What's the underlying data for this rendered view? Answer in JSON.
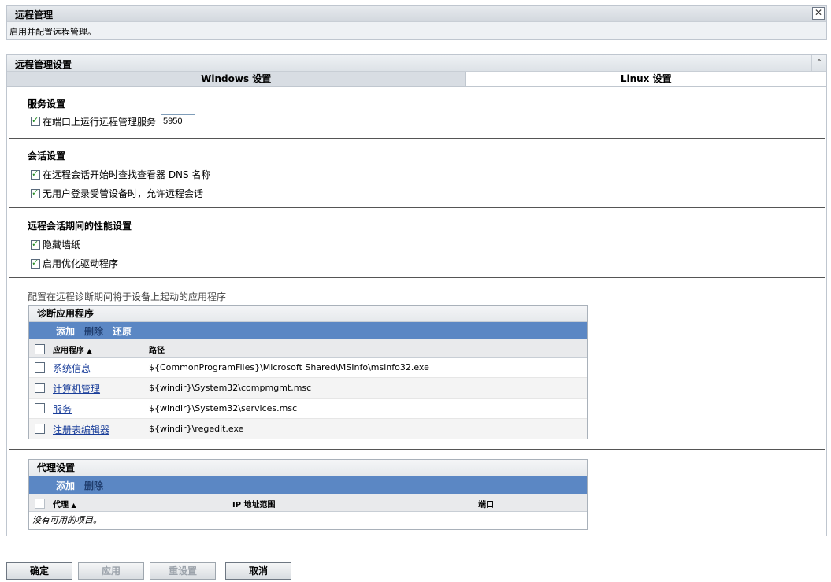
{
  "banner": {
    "title": "远程管理",
    "description": "启用并配置远程管理。"
  },
  "panel": {
    "title": "远程管理设置",
    "tabs": [
      {
        "label": "Windows 设置",
        "active": true
      },
      {
        "label": "Linux 设置",
        "active": false
      }
    ]
  },
  "service": {
    "title": "服务设置",
    "run_on_port_label": "在端口上运行远程管理服务",
    "run_on_port_checked": true,
    "port_value": "5950"
  },
  "session": {
    "title": "会话设置",
    "items": [
      {
        "label": "在远程会话开始时查找查看器 DNS 名称",
        "checked": true
      },
      {
        "label": "无用户登录受管设备时，允许远程会话",
        "checked": true
      }
    ]
  },
  "performance": {
    "title": "远程会话期间的性能设置",
    "items": [
      {
        "label": "隐藏墙纸",
        "checked": true
      },
      {
        "label": "启用优化驱动程序",
        "checked": true
      }
    ]
  },
  "diagnostics": {
    "note": "配置在远程诊断期间将于设备上起动的应用程序",
    "title": "诊断应用程序",
    "toolbar": {
      "add": "添加",
      "delete": "删除",
      "restore": "还原"
    },
    "columns": {
      "app": "应用程序",
      "path": "路径"
    },
    "rows": [
      {
        "app": "系统信息",
        "path": "${CommonProgramFiles}\\Microsoft Shared\\MSInfo\\msinfo32.exe"
      },
      {
        "app": "计算机管理",
        "path": "${windir}\\System32\\compmgmt.msc"
      },
      {
        "app": "服务",
        "path": "${windir}\\System32\\services.msc"
      },
      {
        "app": "注册表编辑器",
        "path": "${windir}\\regedit.exe"
      }
    ]
  },
  "proxy": {
    "title": "代理设置",
    "toolbar": {
      "add": "添加",
      "delete": "删除"
    },
    "columns": {
      "proxy": "代理",
      "ip_range": "IP 地址范围",
      "port": "端口"
    },
    "empty": "没有可用的项目。"
  },
  "buttons": {
    "ok": "确定",
    "apply": "应用",
    "reset": "重设置",
    "cancel": "取消"
  },
  "sort_glyph": "▲",
  "close_glyph": "✕",
  "collapse_glyph": "⌃"
}
